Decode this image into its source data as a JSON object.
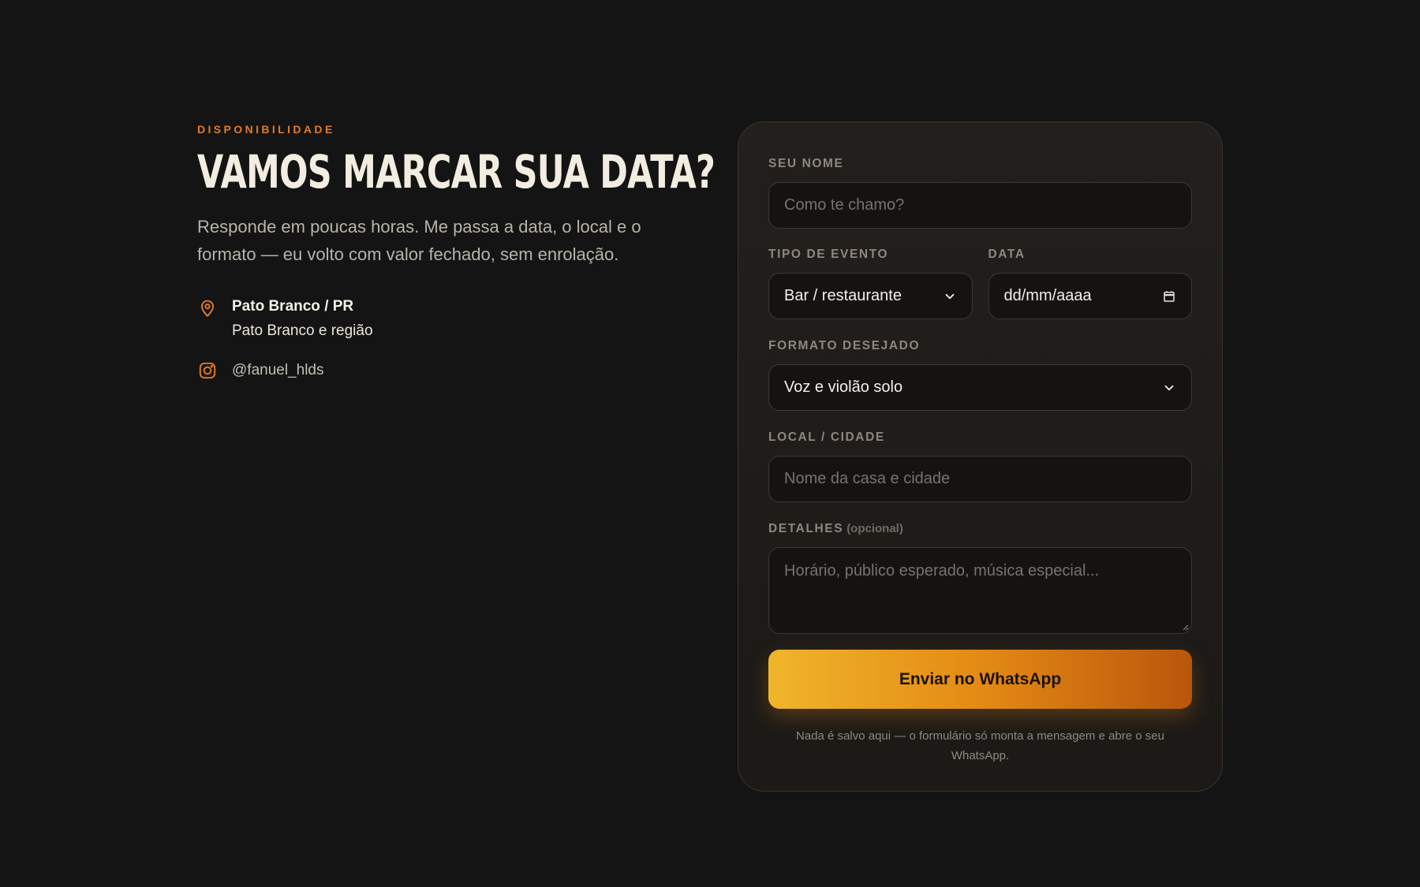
{
  "intro": {
    "eyebrow": "DISPONIBILIDADE",
    "headline": "VAMOS MARCAR SUA DATA?",
    "lede": "Responde em poucas horas. Me passa a data, o local e o formato — eu volto com valor fechado, sem enrolação.",
    "location": {
      "city": "Pato Branco / PR",
      "region": "Pato Branco e região",
      "icon": "map-pin-icon"
    },
    "instagram": {
      "handle": "@fanuel_hlds",
      "icon": "instagram-icon"
    },
    "accent_color": "#e07a2a"
  },
  "form": {
    "name": {
      "label": "SEU NOME",
      "placeholder": "Como te chamo?"
    },
    "event_type": {
      "label": "TIPO DE EVENTO",
      "value": "Bar / restaurante"
    },
    "date": {
      "label": "DATA",
      "value": "dd/mm/aaaa"
    },
    "format": {
      "label": "FORMATO DESEJADO",
      "value": "Voz e violão solo"
    },
    "place": {
      "label": "LOCAL / CIDADE",
      "placeholder": "Nome da casa e cidade"
    },
    "details": {
      "label": "DETALHES",
      "optional": "(opcional)",
      "placeholder": "Horário, público esperado, música especial..."
    },
    "submit_label": "Enviar no WhatsApp",
    "note": "Nada é salvo aqui — o formulário só monta a mensagem e abre o seu WhatsApp.",
    "button_gradient": [
      "#f0b52b",
      "#e48a14",
      "#b8560c"
    ]
  }
}
